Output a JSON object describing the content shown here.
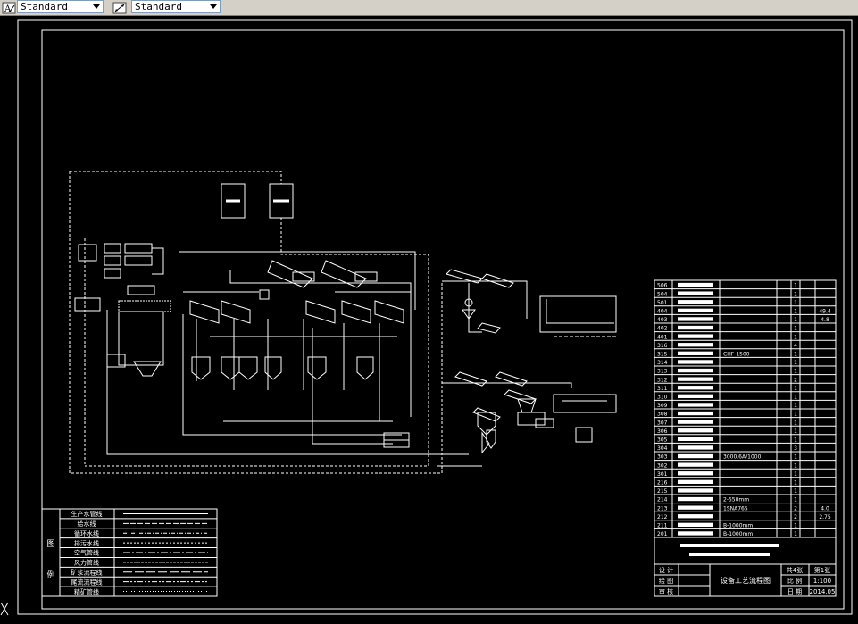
{
  "toolbar": {
    "text_style": "Standard",
    "dim_style": "Standard"
  },
  "table": {
    "rows": [
      {
        "no": "506",
        "qty": "1"
      },
      {
        "no": "504",
        "qty": "1"
      },
      {
        "no": "501",
        "qty": "1"
      },
      {
        "no": "404",
        "qty": "1",
        "val": "49.4"
      },
      {
        "no": "403",
        "qty": "1",
        "val": "4.8"
      },
      {
        "no": "402",
        "qty": "1"
      },
      {
        "no": "401",
        "qty": "1"
      },
      {
        "no": "316",
        "qty": "4"
      },
      {
        "no": "315",
        "qty": "1"
      },
      {
        "no": "314",
        "qty": "1"
      },
      {
        "no": "313",
        "qty": "1"
      },
      {
        "no": "312",
        "qty": "2"
      },
      {
        "no": "311",
        "qty": "1"
      },
      {
        "no": "310",
        "qty": "1"
      },
      {
        "no": "309",
        "qty": "1"
      },
      {
        "no": "308",
        "qty": "1"
      },
      {
        "no": "307",
        "qty": "1"
      },
      {
        "no": "306",
        "qty": "1"
      },
      {
        "no": "305",
        "qty": "1"
      },
      {
        "no": "304",
        "qty": "3"
      },
      {
        "no": "303",
        "qty": "1"
      },
      {
        "no": "302",
        "qty": "1"
      },
      {
        "no": "301",
        "qty": "1"
      },
      {
        "no": "216",
        "qty": "1"
      },
      {
        "no": "215",
        "qty": "1"
      },
      {
        "no": "214",
        "qty": "1"
      },
      {
        "no": "213",
        "qty": "2",
        "val": "4.0"
      },
      {
        "no": "212",
        "qty": "2",
        "val": "2.75"
      },
      {
        "no": "211",
        "qty": "1"
      },
      {
        "no": "201",
        "qty": "1"
      }
    ],
    "specs": {
      "315": "CHF-1500",
      "303": "3000.6A/1000",
      "214": "2-550mm",
      "213": "1SNA765",
      "211": "B-1000mm",
      "201": "B-1000mm"
    }
  },
  "title_block": {
    "sheet_count": "共4张",
    "sheet_no": "第1张",
    "scale_label": "比 例",
    "scale": "1:100",
    "date_label": "日 期",
    "date": "2014.05",
    "design": "设 计",
    "draw": "绘 图",
    "check": "审 核",
    "title": "设备工艺流程图"
  },
  "legend": {
    "side_chars": [
      "图",
      "例"
    ],
    "items": [
      "生产水管线",
      "给水线",
      "循环水线",
      "排污水线",
      "空气管线",
      "风力管线",
      "矿浆流程线",
      "尾流流程线",
      "精矿管线"
    ]
  },
  "icons": {
    "text_style_icon": "text-style-icon",
    "dim_style_icon": "dimension-style-icon",
    "ucs_icon": "ucs-icon"
  },
  "colors": {
    "background": "#000000",
    "lines": "#ffffff",
    "toolbar": "#d4d0c8"
  }
}
